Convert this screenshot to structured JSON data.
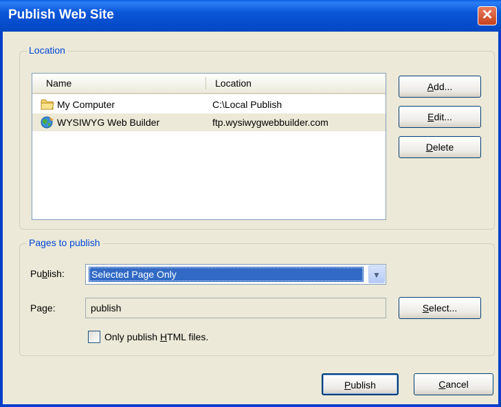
{
  "window": {
    "title": "Publish Web Site",
    "close_glyph": "✕"
  },
  "location": {
    "legend": "Location",
    "columns": [
      "Name",
      "Location"
    ],
    "rows": [
      {
        "name": "My Computer",
        "location": "C:\\Local Publish",
        "icon": "folder-icon"
      },
      {
        "name": "WYSIWYG Web Builder",
        "location": "ftp.wysiwygwebbuilder.com",
        "icon": "globe-icon"
      }
    ],
    "buttons": {
      "add": {
        "mnemonic": "A",
        "rest": "dd..."
      },
      "edit": {
        "mnemonic": "E",
        "rest": "dit..."
      },
      "delete": {
        "mnemonic": "D",
        "rest": "elete"
      }
    }
  },
  "pages": {
    "legend": "Pages to publish",
    "publish_label": {
      "pre": "Pu",
      "mnemonic": "b",
      "post": "lish:"
    },
    "publish_value": "Selected Page Only",
    "page_label": "Page:",
    "page_value": "publish",
    "select_button": {
      "mnemonic": "S",
      "rest": "elect..."
    },
    "checkbox": {
      "pre": "Only publish ",
      "mnemonic": "H",
      "post": "TML files.",
      "checked": false
    }
  },
  "footer": {
    "publish_button": {
      "mnemonic": "P",
      "rest": "ublish"
    },
    "cancel_button": {
      "mnemonic": "C",
      "rest": "ancel"
    }
  }
}
